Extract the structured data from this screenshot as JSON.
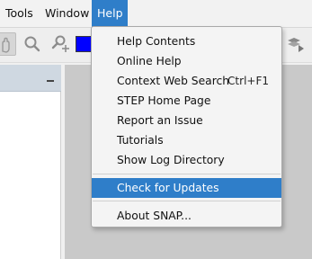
{
  "menubar": {
    "items": [
      {
        "label": "Tools"
      },
      {
        "label": "Window"
      },
      {
        "label": "Help"
      }
    ]
  },
  "toolbar": {
    "buttons": [
      {
        "icon": "pan-hand-icon"
      },
      {
        "icon": "zoom-icon"
      },
      {
        "icon": "zoom-add-icon"
      },
      {
        "icon": "color-swatch"
      },
      {
        "icon": "layer-icon"
      }
    ],
    "swatch_color": "#0000ff"
  },
  "help_menu": {
    "items": [
      {
        "label": "Help Contents",
        "accelerator": ""
      },
      {
        "label": "Online Help",
        "accelerator": ""
      },
      {
        "label": "Context Web Search",
        "accelerator": "Ctrl+F1"
      },
      {
        "label": "STEP Home Page",
        "accelerator": ""
      },
      {
        "label": "Report an Issue",
        "accelerator": ""
      },
      {
        "label": "Tutorials",
        "accelerator": ""
      },
      {
        "label": "Show Log Directory",
        "accelerator": ""
      },
      {
        "label": "Check for Updates",
        "accelerator": ""
      },
      {
        "label": "About SNAP...",
        "accelerator": ""
      }
    ]
  },
  "colors": {
    "accent": "#2f7ec9",
    "panel_header": "#cfd8e1",
    "work_area": "#c9c9c9"
  }
}
